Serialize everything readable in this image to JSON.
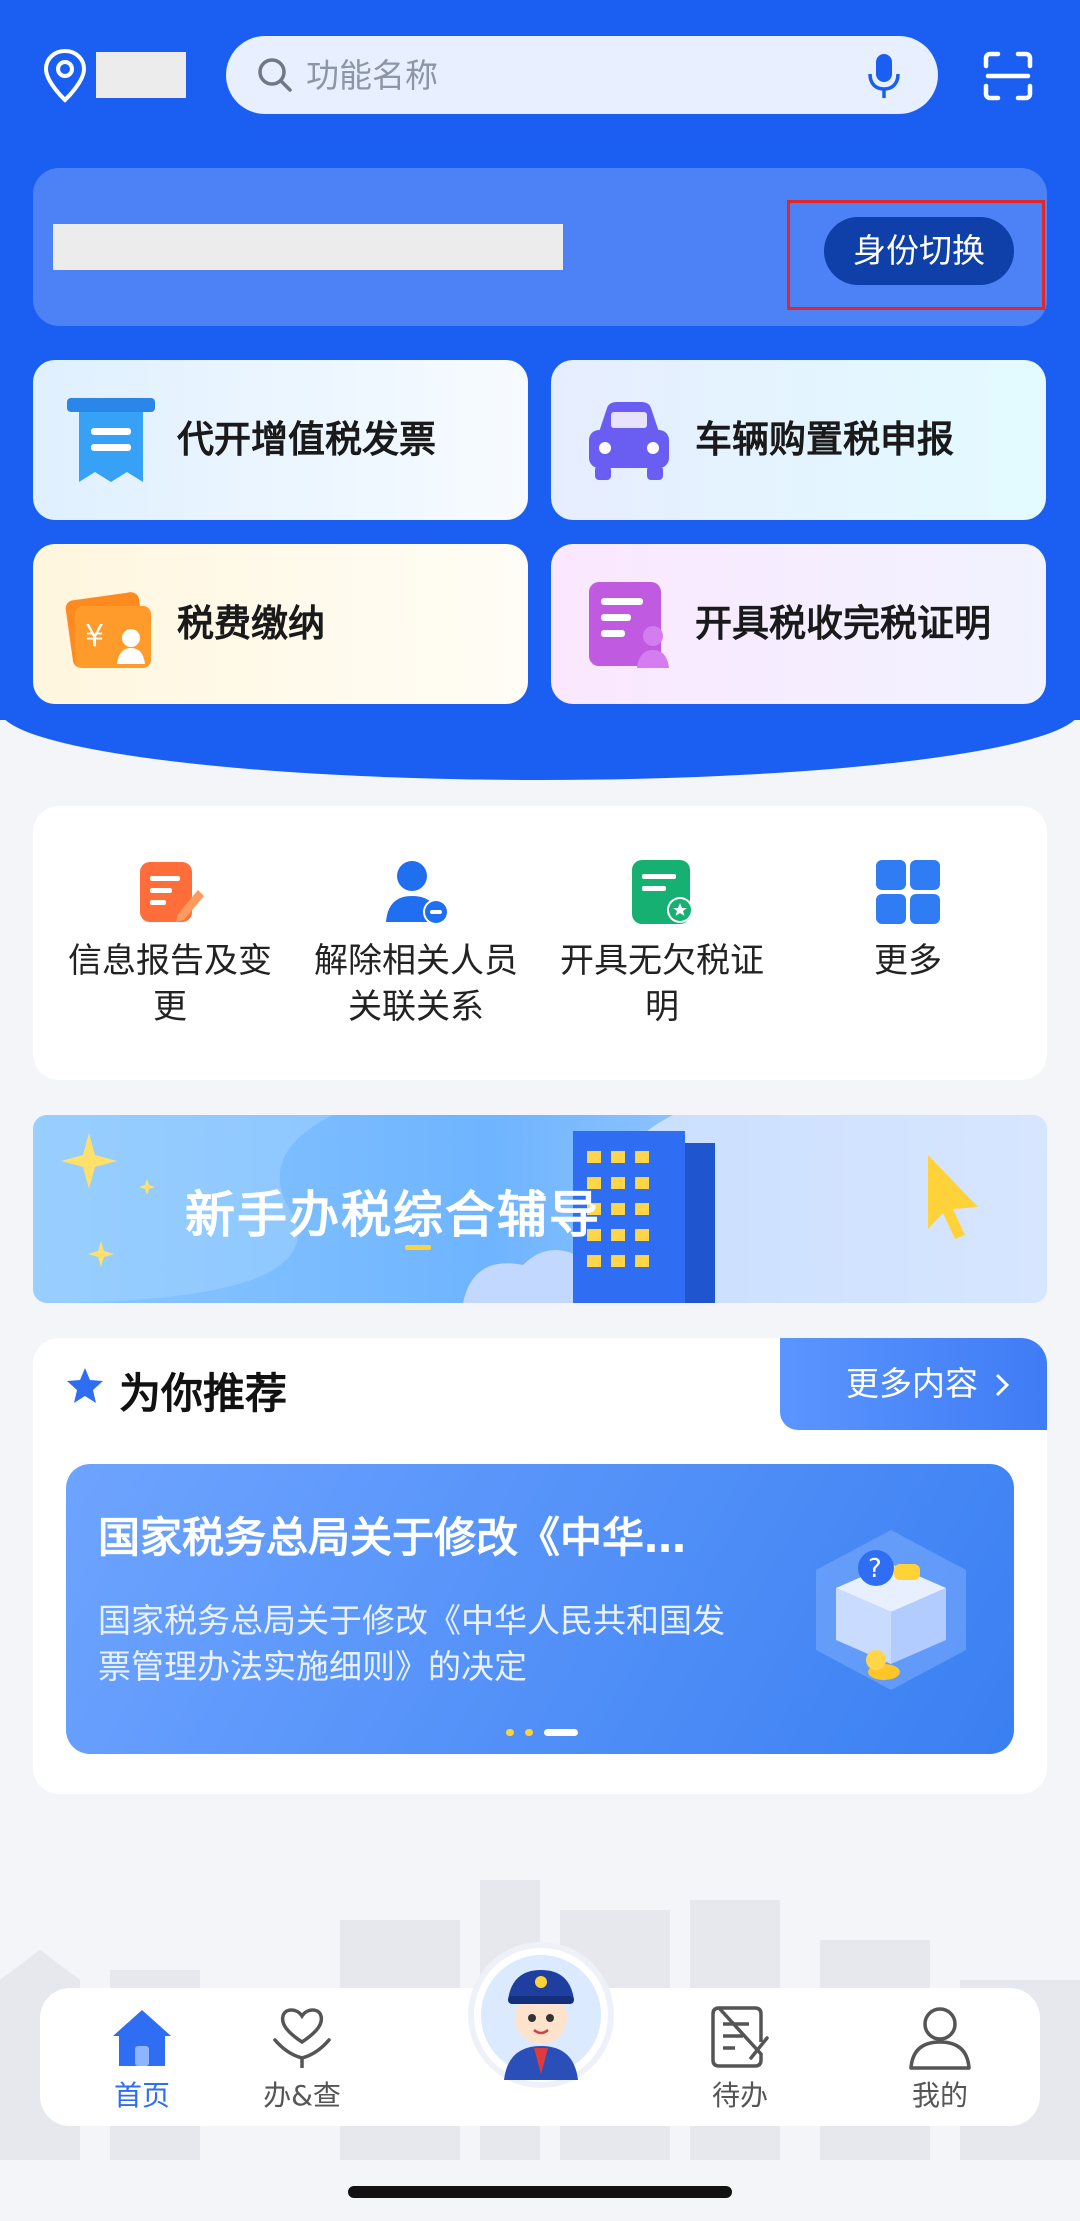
{
  "search": {
    "placeholder": "功能名称"
  },
  "identity": {
    "switch_label": "身份切换"
  },
  "quick_tiles": [
    {
      "label": "代开增值税发票",
      "icon": "invoice-icon"
    },
    {
      "label": "车辆购置税申报",
      "icon": "car-icon"
    },
    {
      "label": "税费缴纳",
      "icon": "wallet-icon"
    },
    {
      "label": "开具税收完税证明",
      "icon": "certificate-icon"
    }
  ],
  "services": [
    {
      "label": "信息报告及变更",
      "icon": "edit-report-icon"
    },
    {
      "label": "解除相关人员关联关系",
      "icon": "user-remove-icon"
    },
    {
      "label": "开具无欠税证明",
      "icon": "certificate-star-icon"
    },
    {
      "label": "更多",
      "icon": "grid-icon"
    }
  ],
  "banner": {
    "text": "新手办税综合辅导"
  },
  "recommend": {
    "title": "为你推荐",
    "more_label": "更多内容",
    "card": {
      "title": "国家税务总局关于修改《中华…",
      "desc": "国家税务总局关于修改《中华人民共和国发票管理办法实施细则》的决定"
    }
  },
  "tabbar": [
    {
      "label": "首页",
      "active": true
    },
    {
      "label": "办&查"
    },
    {
      "label": "待办"
    },
    {
      "label": "我的"
    }
  ],
  "colors": {
    "brand": "#1a5ff2",
    "accent": "#2f6ef2",
    "highlight": "#e0272a"
  }
}
